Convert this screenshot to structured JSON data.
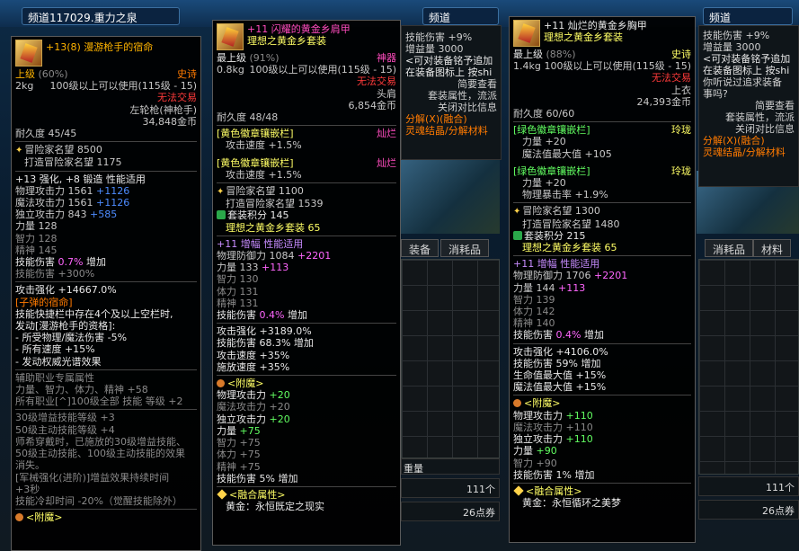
{
  "channel": {
    "text": "频道117029.重力之泉",
    "text2": "频道",
    "text3": "频道"
  },
  "background": {
    "tabs": [
      "装备",
      "消耗品"
    ],
    "tabs2": [
      "消耗品",
      "材料"
    ],
    "left_panel_lines": [
      "技能伤害 +9%",
      "增益量 3000",
      "<可对装备铭予追加",
      "在装备图标上 按shi",
      "简要查看",
      "套装属性，流派",
      "关闭对比信息",
      "分解(X)(融合)",
      "灵魂结晶/分解材料"
    ],
    "right_panel_lines": [
      "技能伤害 +9%",
      "增益量 3000",
      "<可对装备铭予追加",
      "在装备图标上 按shi",
      "你听说过追求装备",
      "事吗?",
      "简要查看",
      "套装属性，流派",
      "关闭对比信息",
      "分解(X)(融合)",
      "灵魂结晶/分解材料"
    ],
    "weight_label": "重量",
    "count1": "111个",
    "count2": "111个",
    "coupon1": "26点券",
    "coupon2": "26点券"
  },
  "tooltip1": {
    "title": "+13(8) 漫游枪手的宿命",
    "grade": "上级",
    "grade_pct": "(60%)",
    "rarity": "史诗",
    "weight": "2kg",
    "level_req": "100级以上可以使用(115级 - 15)",
    "trade": "无法交易",
    "type": "左轮枪(神枪手)",
    "price": "34,848金币",
    "durability": "耐久度 45/45",
    "fame_lines": [
      "冒险家名望 8500",
      "打造冒险家名望 1175"
    ],
    "enhance": "+13 强化, +8 锻造 性能适用",
    "stats": [
      {
        "label": "物理攻击力 1561",
        "bonus": "+1126"
      },
      {
        "label": "魔法攻击力 1561",
        "bonus": "+1126"
      },
      {
        "label": "独立攻击力 843",
        "bonus": "+585"
      },
      {
        "label": "力量 128",
        "bonus": ""
      },
      {
        "label": "智力 128",
        "bonus": ""
      },
      {
        "label": "精神 145",
        "bonus": ""
      }
    ],
    "skill_dmg": "技能伤害",
    "skill_dmg_pct": "0.7%",
    "skill_dmg_suffix": "增加",
    "skill_dmg2": "技能伤害 +300%",
    "attack_str": "攻击强化 +14667.0%",
    "bullet_title": "[子弹的宿命]",
    "bullet_lines": [
      "技能快捷栏中存在4个及以上空栏时,",
      "发动[漫游枪手的资格]:",
      "- 所受物理/魔法伤害 -5%",
      "- 所有速度 +15%",
      "- 发动权威光谱效果"
    ],
    "support_lines": [
      "辅助职业专属属性",
      "力量、智力、体力、精神 +58",
      "所有职业[^]100级全部 技能 等级 +2"
    ],
    "grey_lines": [
      "30级增益技能等级 +3",
      "50级主动技能等级 +4",
      "师希穿戴时，已施放的30级增益技能、",
      "50级主动技能、100级主动技能的效果",
      "消失。",
      "[军械强化(进阶)]增益效果持续时间",
      "+3秒",
      "技能冷却时间 -20%（觉醒技能除外）"
    ],
    "enchant": "<附魔>"
  },
  "tooltip2": {
    "title": "+11 闪耀的黄金乡肩甲",
    "subtitle": "理想之黄金乡套装",
    "grade": "最上级",
    "grade_pct": "(91%)",
    "rarity": "神器",
    "weight": "0.8kg",
    "level_req": "100级以上可以使用(115级 - 15)",
    "trade": "无法交易",
    "type": "头肩",
    "price": "6,854金币",
    "durability": "耐久度 48/48",
    "emblem1_title": "[黄色徽章镶嵌栏]",
    "emblem1_tag": "灿烂",
    "emblem1_stat": "攻击速度 +1.5%",
    "emblem2_title": "[黄色徽章镶嵌栏]",
    "emblem2_tag": "灿烂",
    "emblem2_stat": "攻击速度 +1.5%",
    "fame_lines": [
      "冒险家名望 1100",
      "打造冒险家名望 1539"
    ],
    "set_points": "套装积分 145",
    "set_name": "理想之黄金乡套装 65",
    "enhance": "+11 增幅 性能适用",
    "stats": [
      {
        "label": "物理防御力 1084",
        "bonus": "+2201"
      },
      {
        "label": "力量 133",
        "bonus": "+113"
      },
      {
        "label": "智力 130",
        "bonus": ""
      },
      {
        "label": "体力 131",
        "bonus": ""
      },
      {
        "label": "精神 131",
        "bonus": ""
      }
    ],
    "skill_dmg": "技能伤害",
    "skill_dmg_pct": "0.4%",
    "skill_dmg_suffix": "增加",
    "extra_lines": [
      "攻击强化 +3189.0%",
      "技能伤害 68.3% 增加",
      "攻击速度 +35%",
      "施放速度 +35%"
    ],
    "enchant": "<附魔>",
    "enchant_stats": [
      {
        "label": "物理攻击力",
        "val": "+20",
        "dim": false
      },
      {
        "label": "魔法攻击力",
        "val": "+20",
        "dim": true
      },
      {
        "label": "独立攻击力",
        "val": "+20",
        "dim": false
      },
      {
        "label": "力量",
        "val": "+75",
        "dim": false
      },
      {
        "label": "智力",
        "val": "+75",
        "dim": true
      },
      {
        "label": "体力",
        "val": "+75",
        "dim": true
      },
      {
        "label": "精神",
        "val": "+75",
        "dim": true
      }
    ],
    "enchant_skill": "技能伤害 5% 增加",
    "fusion": "<融合属性>",
    "fusion_val": "黄金：永恒既定之现实"
  },
  "tooltip3": {
    "title": "+11 灿烂的黄金乡胸甲",
    "subtitle": "理想之黄金乡套装",
    "grade": "最上级",
    "grade_pct": "(88%)",
    "rarity": "史诗",
    "weight": "1.4kg",
    "level_req": "100级以上可以使用(115级 - 15)",
    "trade": "无法交易",
    "type": "上衣",
    "price": "24,393金币",
    "durability": "耐久度 60/60",
    "emblem1_title": "[绿色徽章镶嵌栏]",
    "emblem1_tag": "玲珑",
    "emblem1_stats": [
      "力量 +20",
      "魔法值最大值 +105"
    ],
    "emblem2_title": "[绿色徽章镶嵌栏]",
    "emblem2_tag": "玲珑",
    "emblem2_stats": [
      "力量 +20",
      "物理暴击率 +1.9%"
    ],
    "fame_lines": [
      "冒险家名望 1300",
      "打造冒险家名望 1480"
    ],
    "set_points": "套装积分 215",
    "set_name": "理想之黄金乡套装 65",
    "enhance": "+11 增幅 性能适用",
    "stats": [
      {
        "label": "物理防御力 1706",
        "bonus": "+2201"
      },
      {
        "label": "力量 144",
        "bonus": "+113"
      },
      {
        "label": "智力 139",
        "bonus": ""
      },
      {
        "label": "体力 142",
        "bonus": ""
      },
      {
        "label": "精神 140",
        "bonus": ""
      }
    ],
    "skill_dmg": "技能伤害",
    "skill_dmg_pct": "0.4%",
    "skill_dmg_suffix": "增加",
    "extra_lines": [
      "攻击强化 +4106.0%",
      "技能伤害 59% 增加",
      "生命值最大值 +15%",
      "魔法值最大值 +15%"
    ],
    "enchant": "<附魔>",
    "enchant_stats": [
      {
        "label": "物理攻击力",
        "val": "+110",
        "dim": false
      },
      {
        "label": "魔法攻击力",
        "val": "+110",
        "dim": true
      },
      {
        "label": "独立攻击力",
        "val": "+110",
        "dim": false
      },
      {
        "label": "力量",
        "val": "+90",
        "dim": false
      },
      {
        "label": "智力",
        "val": "+90",
        "dim": true
      }
    ],
    "enchant_skill": "技能伤害 1% 增加",
    "fusion": "<融合属性>",
    "fusion_val": "黄金：永恒循环之美梦"
  }
}
